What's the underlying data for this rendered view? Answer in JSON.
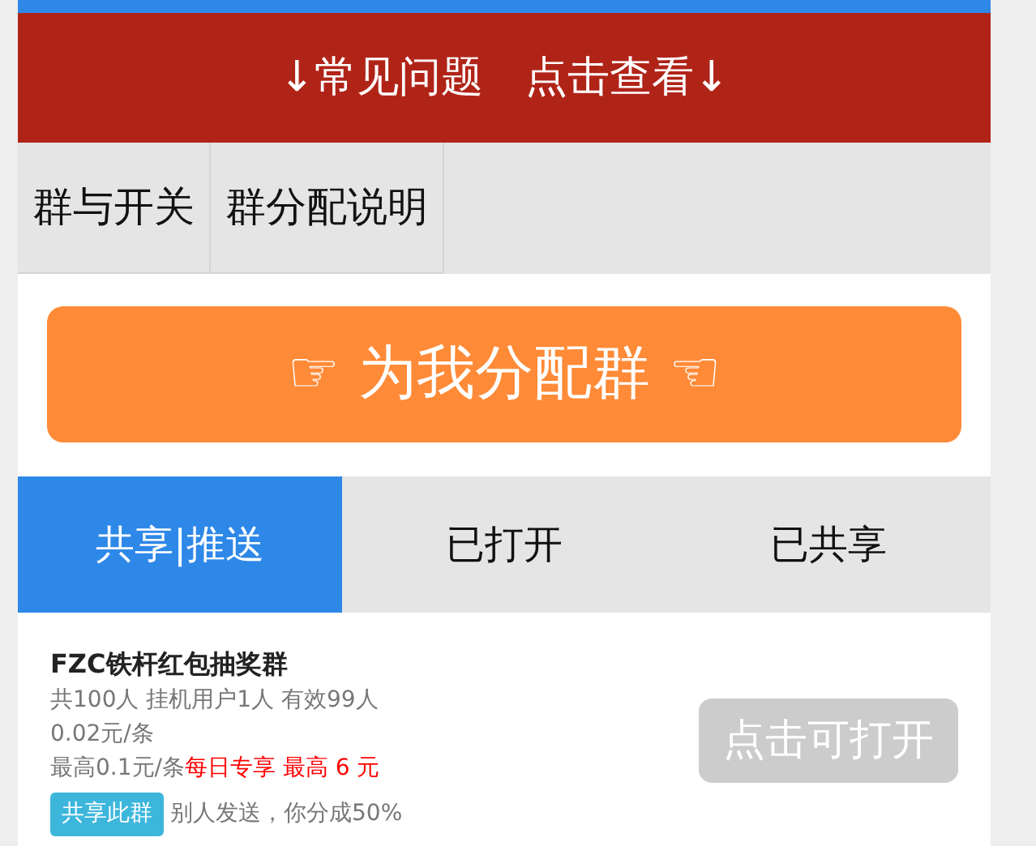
{
  "banner": {
    "text": "↓常见问题　点击查看↓"
  },
  "top_tabs": [
    {
      "label": "群与开关"
    },
    {
      "label": "群分配说明"
    }
  ],
  "assign_button": {
    "label": "☞ 为我分配群 ☜"
  },
  "tabs": [
    {
      "label": "共享|推送",
      "selected": true
    },
    {
      "label": "已打开",
      "selected": false
    },
    {
      "label": "已共享",
      "selected": false
    }
  ],
  "groups": [
    {
      "name": "FZC铁杆红包抽奖群",
      "members": "共100人  挂机用户1人  有效99人",
      "price": "0.02元/条",
      "max_price": "最高0.1元/条",
      "promo": "每日专享  最高 6 元",
      "share_button": "共享此群",
      "share_note": "别人发送，你分成50%",
      "open_button": {
        "label": "点击可打开",
        "disabled": true
      }
    }
  ]
}
